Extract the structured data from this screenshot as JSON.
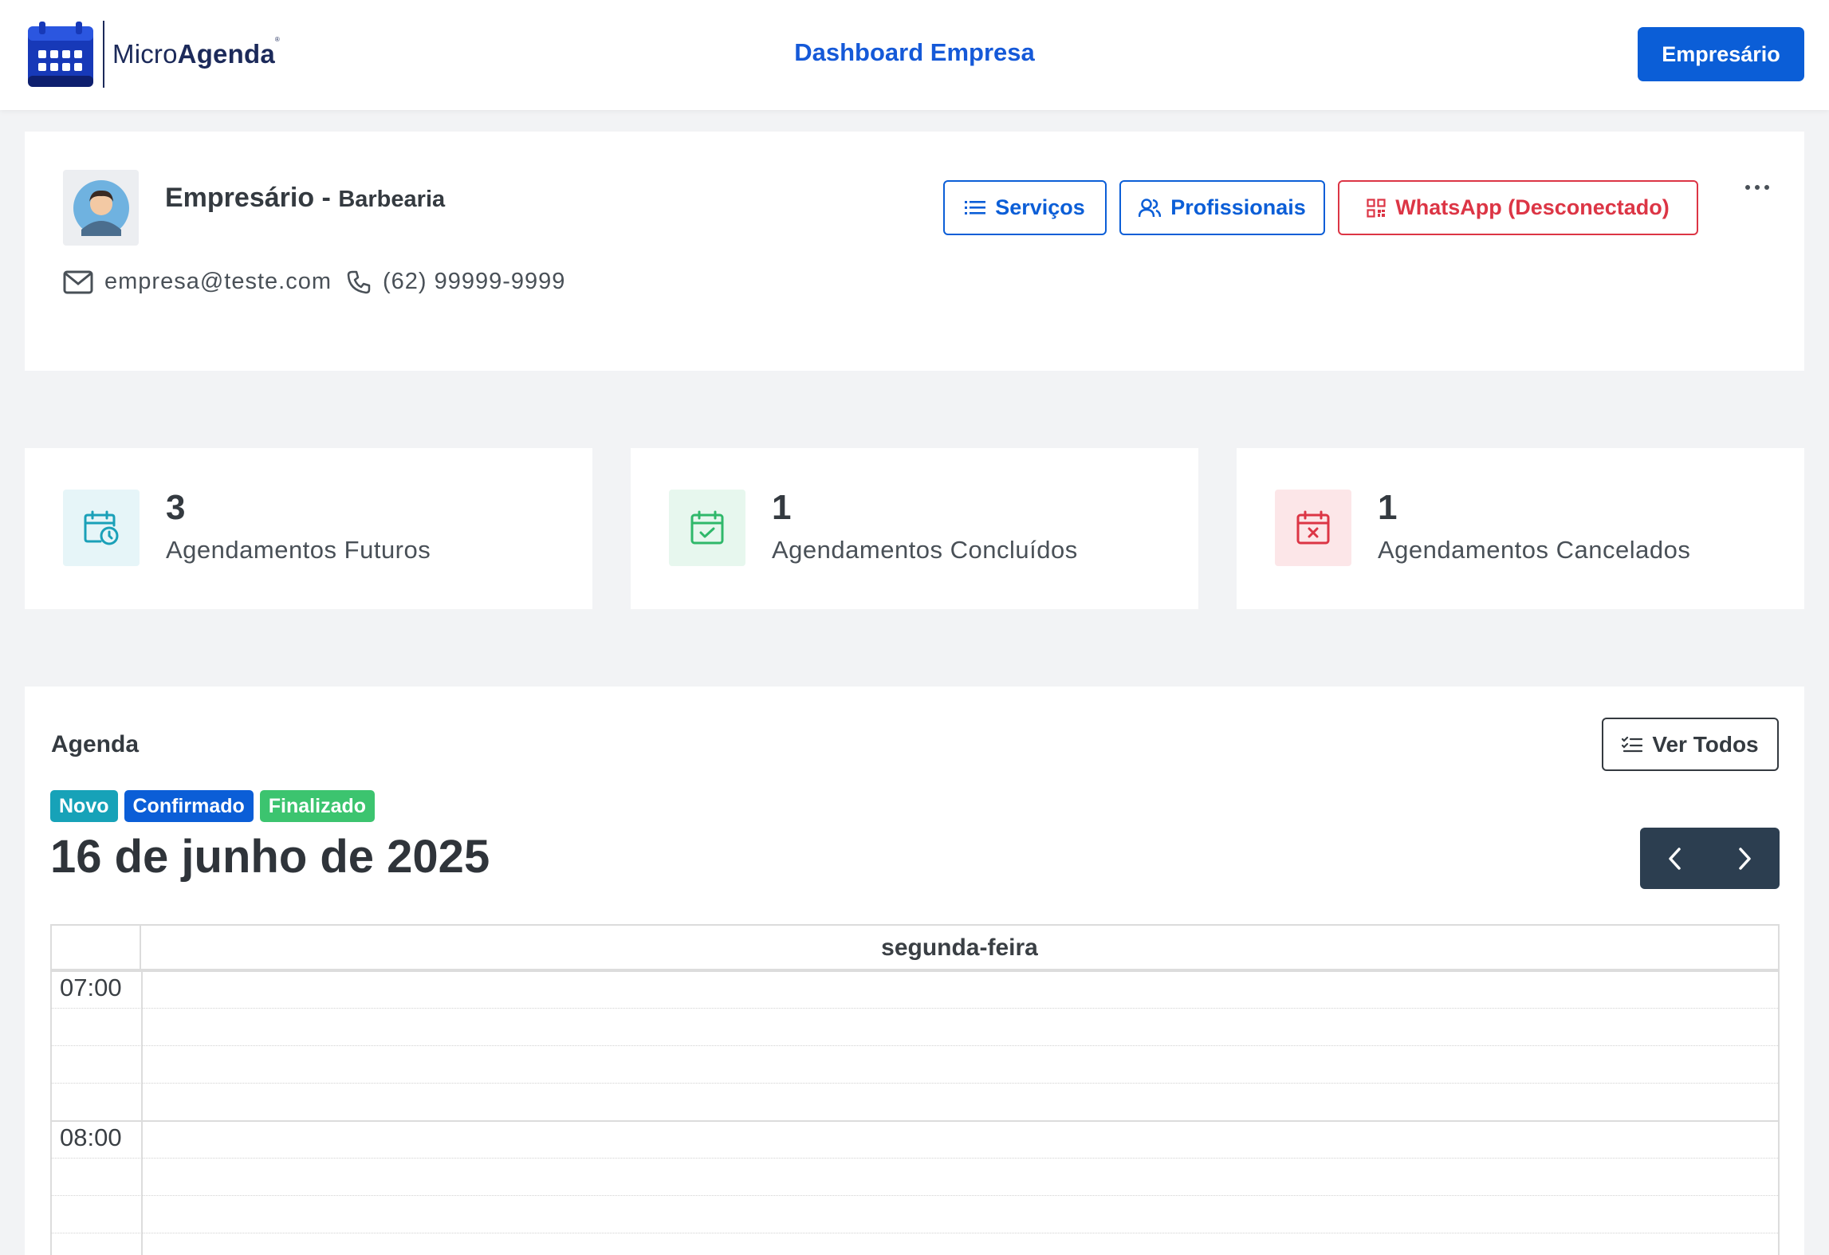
{
  "header": {
    "logo_text_light": "Micro",
    "logo_text_bold": "Agenda",
    "logo_reg": "®",
    "title": "Dashboard Empresa",
    "user_button": "Empresário",
    "brand_color": "#0b5ed7"
  },
  "profile": {
    "name": "Empresário",
    "separator": "-",
    "business": "Barbearia",
    "email": "empresa@teste.com",
    "phone": "(62) 99999-9999",
    "buttons": {
      "services": "Serviços",
      "professionals": "Profissionais",
      "whatsapp": "WhatsApp (Desconectado)"
    }
  },
  "stats": [
    {
      "value": "3",
      "label": "Agendamentos Futuros",
      "color": "#1aa0b8",
      "icon": "calendar-clock-icon"
    },
    {
      "value": "1",
      "label": "Agendamentos Concluídos",
      "color": "#2fb86a",
      "icon": "calendar-check-icon"
    },
    {
      "value": "1",
      "label": "Agendamentos Cancelados",
      "color": "#dc3545",
      "icon": "calendar-x-icon"
    }
  ],
  "agenda": {
    "title": "Agenda",
    "view_all": "Ver Todos",
    "legend": [
      {
        "label": "Novo",
        "color": "#17a2b8"
      },
      {
        "label": "Confirmado",
        "color": "#0b5ed7"
      },
      {
        "label": "Finalizado",
        "color": "#3cc46f"
      }
    ],
    "date": "16 de junho de 2025",
    "day_header": "segunda-feira",
    "times": [
      "07:00",
      "08:00"
    ]
  }
}
